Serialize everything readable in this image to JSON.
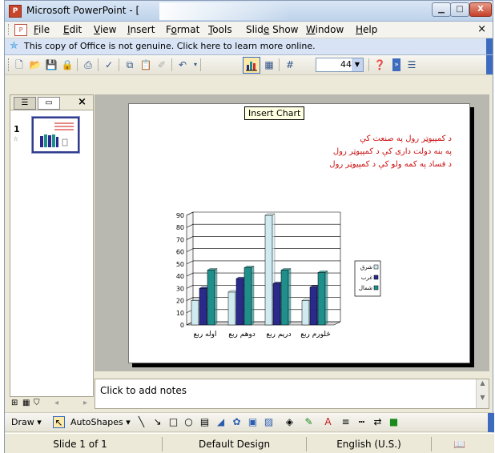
{
  "window": {
    "title": "Microsoft PowerPoint - [",
    "app_icon": "powerpoint-icon",
    "controls": [
      "minimize-icon",
      "maximize-icon",
      "close-icon"
    ]
  },
  "menubar": {
    "items": [
      "File",
      "Edit",
      "View",
      "Insert",
      "Format",
      "Tools",
      "Slide Show",
      "Window",
      "Help"
    ],
    "close_glyph": "×"
  },
  "infobar": {
    "text": "This copy of Office is not genuine.  Click here to learn more online."
  },
  "toolbar": {
    "icons": [
      "new-icon",
      "open-icon",
      "save-icon",
      "permission-icon",
      "print-icon",
      "spelling-icon",
      "copy-icon",
      "paste-icon",
      "format-painter-icon",
      "undo-icon",
      "insert-chart-icon",
      "insert-table-icon",
      "show-grid-icon",
      "help-icon",
      "toolbar-options-icon",
      "slide-design-icon"
    ],
    "zoom": "44%",
    "tooltip": "Insert Chart"
  },
  "left_pane": {
    "tabs": [
      "outline-tab-icon",
      "slides-tab-icon"
    ],
    "close": "×",
    "slide_number": "1"
  },
  "slide": {
    "text_lines": [
      "د کمپیوټر رول په صنعت کې",
      "په بنه دولت داری کې د کمپیوټر رول",
      "د فساد په کمه ولو کې د کمپیوټر رول"
    ]
  },
  "chart_data": {
    "type": "bar",
    "categories": [
      "اوله ربع",
      "دوهم ربع",
      "دریم ربع",
      "څلورم ربع"
    ],
    "series": [
      {
        "name": "شرق",
        "values": [
          20,
          27,
          90,
          20
        ],
        "color": "#cfeaf0"
      },
      {
        "name": "غرب",
        "values": [
          30,
          38,
          34,
          31
        ],
        "color": "#2a2a8c"
      },
      {
        "name": "شمال",
        "values": [
          45,
          47,
          45,
          43
        ],
        "color": "#1f8f8c"
      }
    ],
    "ylim": [
      0,
      90
    ],
    "yticks": [
      0,
      10,
      20,
      30,
      40,
      50,
      60,
      70,
      80,
      90
    ],
    "legend": "right",
    "grid": true
  },
  "notes": {
    "placeholder": "Click to add notes"
  },
  "drawbar": {
    "draw_label": "Draw",
    "autoshapes_label": "AutoShapes"
  },
  "status": {
    "slide": "Slide 1 of 1",
    "design": "Default Design",
    "language": "English (U.S.)"
  },
  "colors": {
    "slide_text": "#cc1111",
    "title_bar": "#bdd2ea",
    "toolbar_edge": "#3d6cbf"
  }
}
